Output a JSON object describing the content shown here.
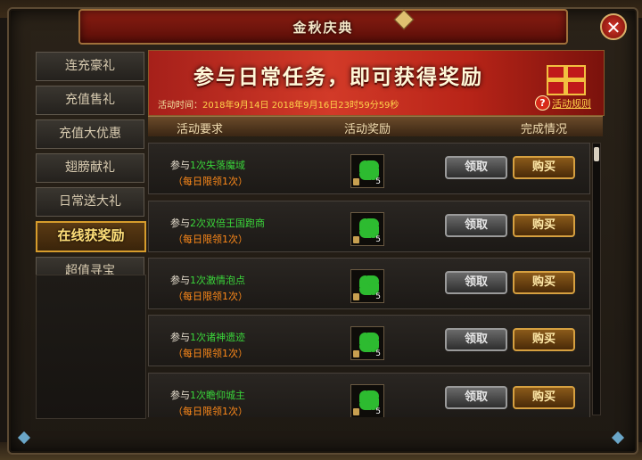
{
  "window": {
    "title": "金秋庆典"
  },
  "sidebar": {
    "items": [
      {
        "label": "连充豪礼"
      },
      {
        "label": "充值售礼"
      },
      {
        "label": "充值大优惠"
      },
      {
        "label": "翅膀献礼"
      },
      {
        "label": "日常送大礼"
      },
      {
        "label": "在线获奖励",
        "active": true
      },
      {
        "label": "超值寻宝"
      }
    ]
  },
  "banner": {
    "headline": "参与日常任务，即可获得奖励",
    "time_label": "活动时间：",
    "time_value": "2018年9月14日  2018年9月16日23时59分59秒",
    "rules_link": "活动规则"
  },
  "table": {
    "headers": {
      "requirement": "活动要求",
      "reward": "活动奖励",
      "status": "完成情况"
    },
    "rows": [
      {
        "prefix": "参与",
        "highlight": "1次失落魔域",
        "limit": "（每日限领1次）",
        "reward_count": "5",
        "claim": "领取",
        "buy": "购买"
      },
      {
        "prefix": "参与",
        "highlight": "2次双倍王国跑商",
        "limit": "（每日限领1次）",
        "reward_count": "5",
        "claim": "领取",
        "buy": "购买"
      },
      {
        "prefix": "参与",
        "highlight": "1次激情泡点",
        "limit": "（每日限领1次）",
        "reward_count": "5",
        "claim": "领取",
        "buy": "购买"
      },
      {
        "prefix": "参与",
        "highlight": "1次诸神遗迹",
        "limit": "（每日限领1次）",
        "reward_count": "5",
        "claim": "领取",
        "buy": "购买"
      },
      {
        "prefix": "参与",
        "highlight": "1次瞻仰城主",
        "limit": "（每日限领1次）",
        "reward_count": "5",
        "claim": "领取",
        "buy": "购买"
      }
    ]
  },
  "colors": {
    "accent_gold": "#d69c2c",
    "highlight_green": "#3ad53a",
    "limit_orange": "#ff8a1a",
    "banner_red": "#d23a28"
  },
  "icons": {
    "close": "close-icon",
    "help": "help-icon",
    "reward_item": "four-leaf-clover-icon"
  }
}
